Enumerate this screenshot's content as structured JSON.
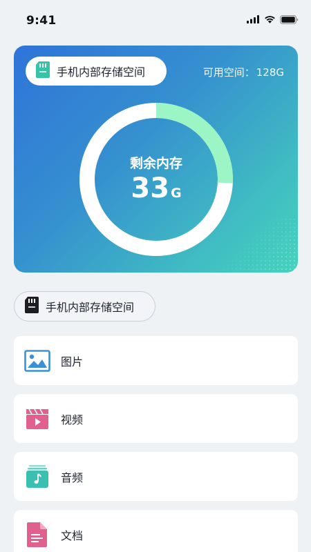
{
  "status_bar": {
    "time": "9:41",
    "icons": [
      "cellular-signal-icon",
      "wifi-icon",
      "battery-icon"
    ]
  },
  "storage_card": {
    "device_label": "手机内部存储空间",
    "available_label": "可用空间：",
    "available_value": "128G",
    "ring_title": "剩余内存",
    "remaining_value": "33",
    "remaining_unit": "G",
    "remaining_fraction": 0.258,
    "colors": {
      "gradient_start": "#2f74d9",
      "gradient_end": "#46d3bd",
      "ring_track": "#ffffff",
      "ring_fill": "#9cf5c4"
    }
  },
  "section_chip": {
    "label": "手机内部存储空间",
    "icon": "sd-card-icon"
  },
  "categories": [
    {
      "label": "图片",
      "icon": "image-icon",
      "color": "#3a8fd6"
    },
    {
      "label": "视频",
      "icon": "video-icon",
      "color": "#e0608e"
    },
    {
      "label": "音频",
      "icon": "audio-icon",
      "color": "#3bbfb1"
    },
    {
      "label": "文档",
      "icon": "document-icon",
      "color": "#e0608e"
    }
  ]
}
